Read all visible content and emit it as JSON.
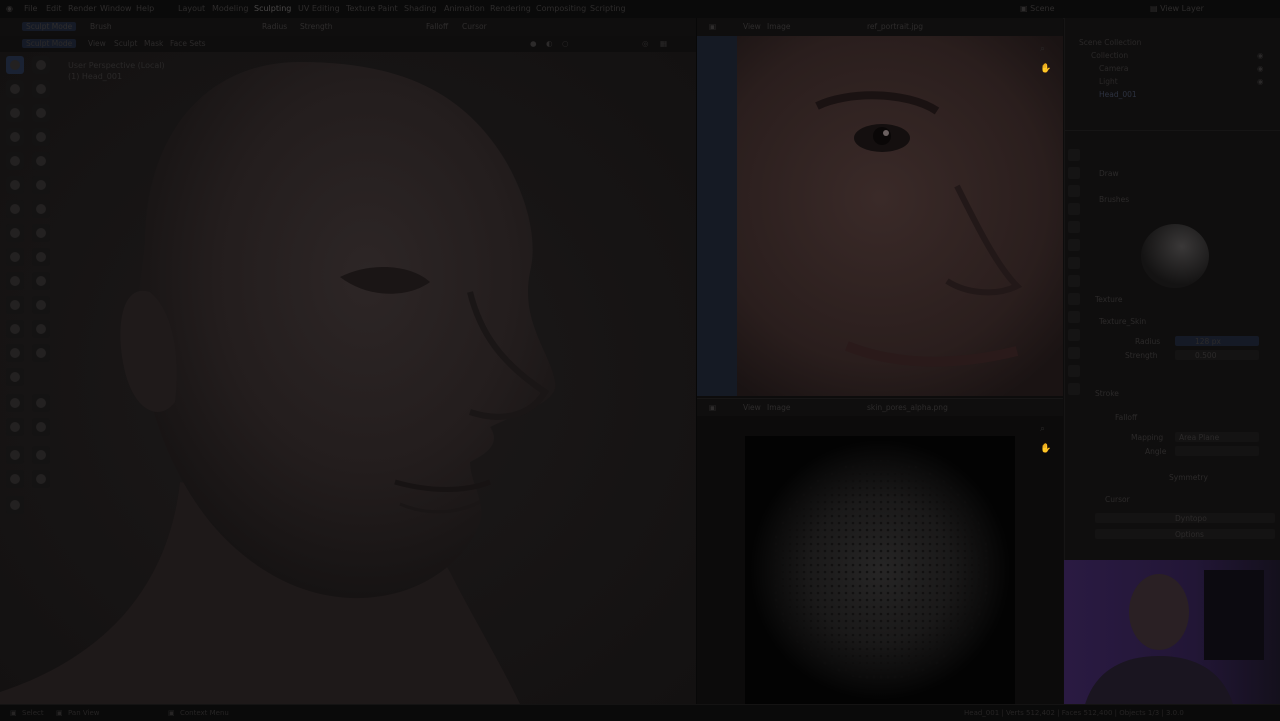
{
  "menu": {
    "items": [
      "File",
      "Edit",
      "Render",
      "Window",
      "Help"
    ],
    "workspaces": [
      "Layout",
      "Modeling",
      "Sculpting",
      "UV Editing",
      "Texture Paint",
      "Shading",
      "Animation",
      "Rendering",
      "Compositing",
      "Scripting"
    ],
    "active_workspace": "Sculpting",
    "scene_label": "Scene",
    "view_layer_label": "View Layer"
  },
  "viewport": {
    "mode": "Sculpt Mode",
    "header_items": [
      "View",
      "Sculpt",
      "Mask",
      "Face Sets"
    ],
    "brush_header": [
      "Brush",
      "Radius",
      "Strength",
      "Falloff",
      "Cursor"
    ],
    "view_label": "User Perspective (Local)",
    "object_label": "(1) Head_001"
  },
  "image_editor_top": {
    "header_items": [
      "View",
      "Image"
    ],
    "image_name": "ref_portrait.jpg"
  },
  "image_editor_bottom": {
    "header_items": [
      "View",
      "Image"
    ],
    "image_name": "skin_pores_alpha.png"
  },
  "outliner": {
    "title": "Scene Collection",
    "items": [
      "Collection",
      "Camera",
      "Light",
      "Head_001"
    ]
  },
  "properties": {
    "brush_section": "Brushes",
    "brush_name": "Draw",
    "texture_section": "Texture",
    "texture_name": "Texture_Skin",
    "radius_label": "Radius",
    "radius_value": "128 px",
    "strength_label": "Strength",
    "strength_value": "0.500",
    "mapping_label": "Mapping",
    "mapping_value": "Area Plane",
    "angle_label": "Angle",
    "stroke_section": "Stroke",
    "falloff_section": "Falloff",
    "cursor_section": "Cursor",
    "dyntopo_section": "Dyntopo",
    "symmetry_label": "Symmetry",
    "options_section": "Options"
  },
  "statusbar": {
    "left_items": [
      "Select",
      "Pan View",
      "Context Menu"
    ],
    "right_text": "Head_001 | Verts 512,402 | Faces 512,400 | Objects 1/3 | 3.0.0"
  },
  "colors": {
    "accent": "#1a2233",
    "background": "#0d0c0c",
    "webcam_glow": "#3a1f5a"
  }
}
